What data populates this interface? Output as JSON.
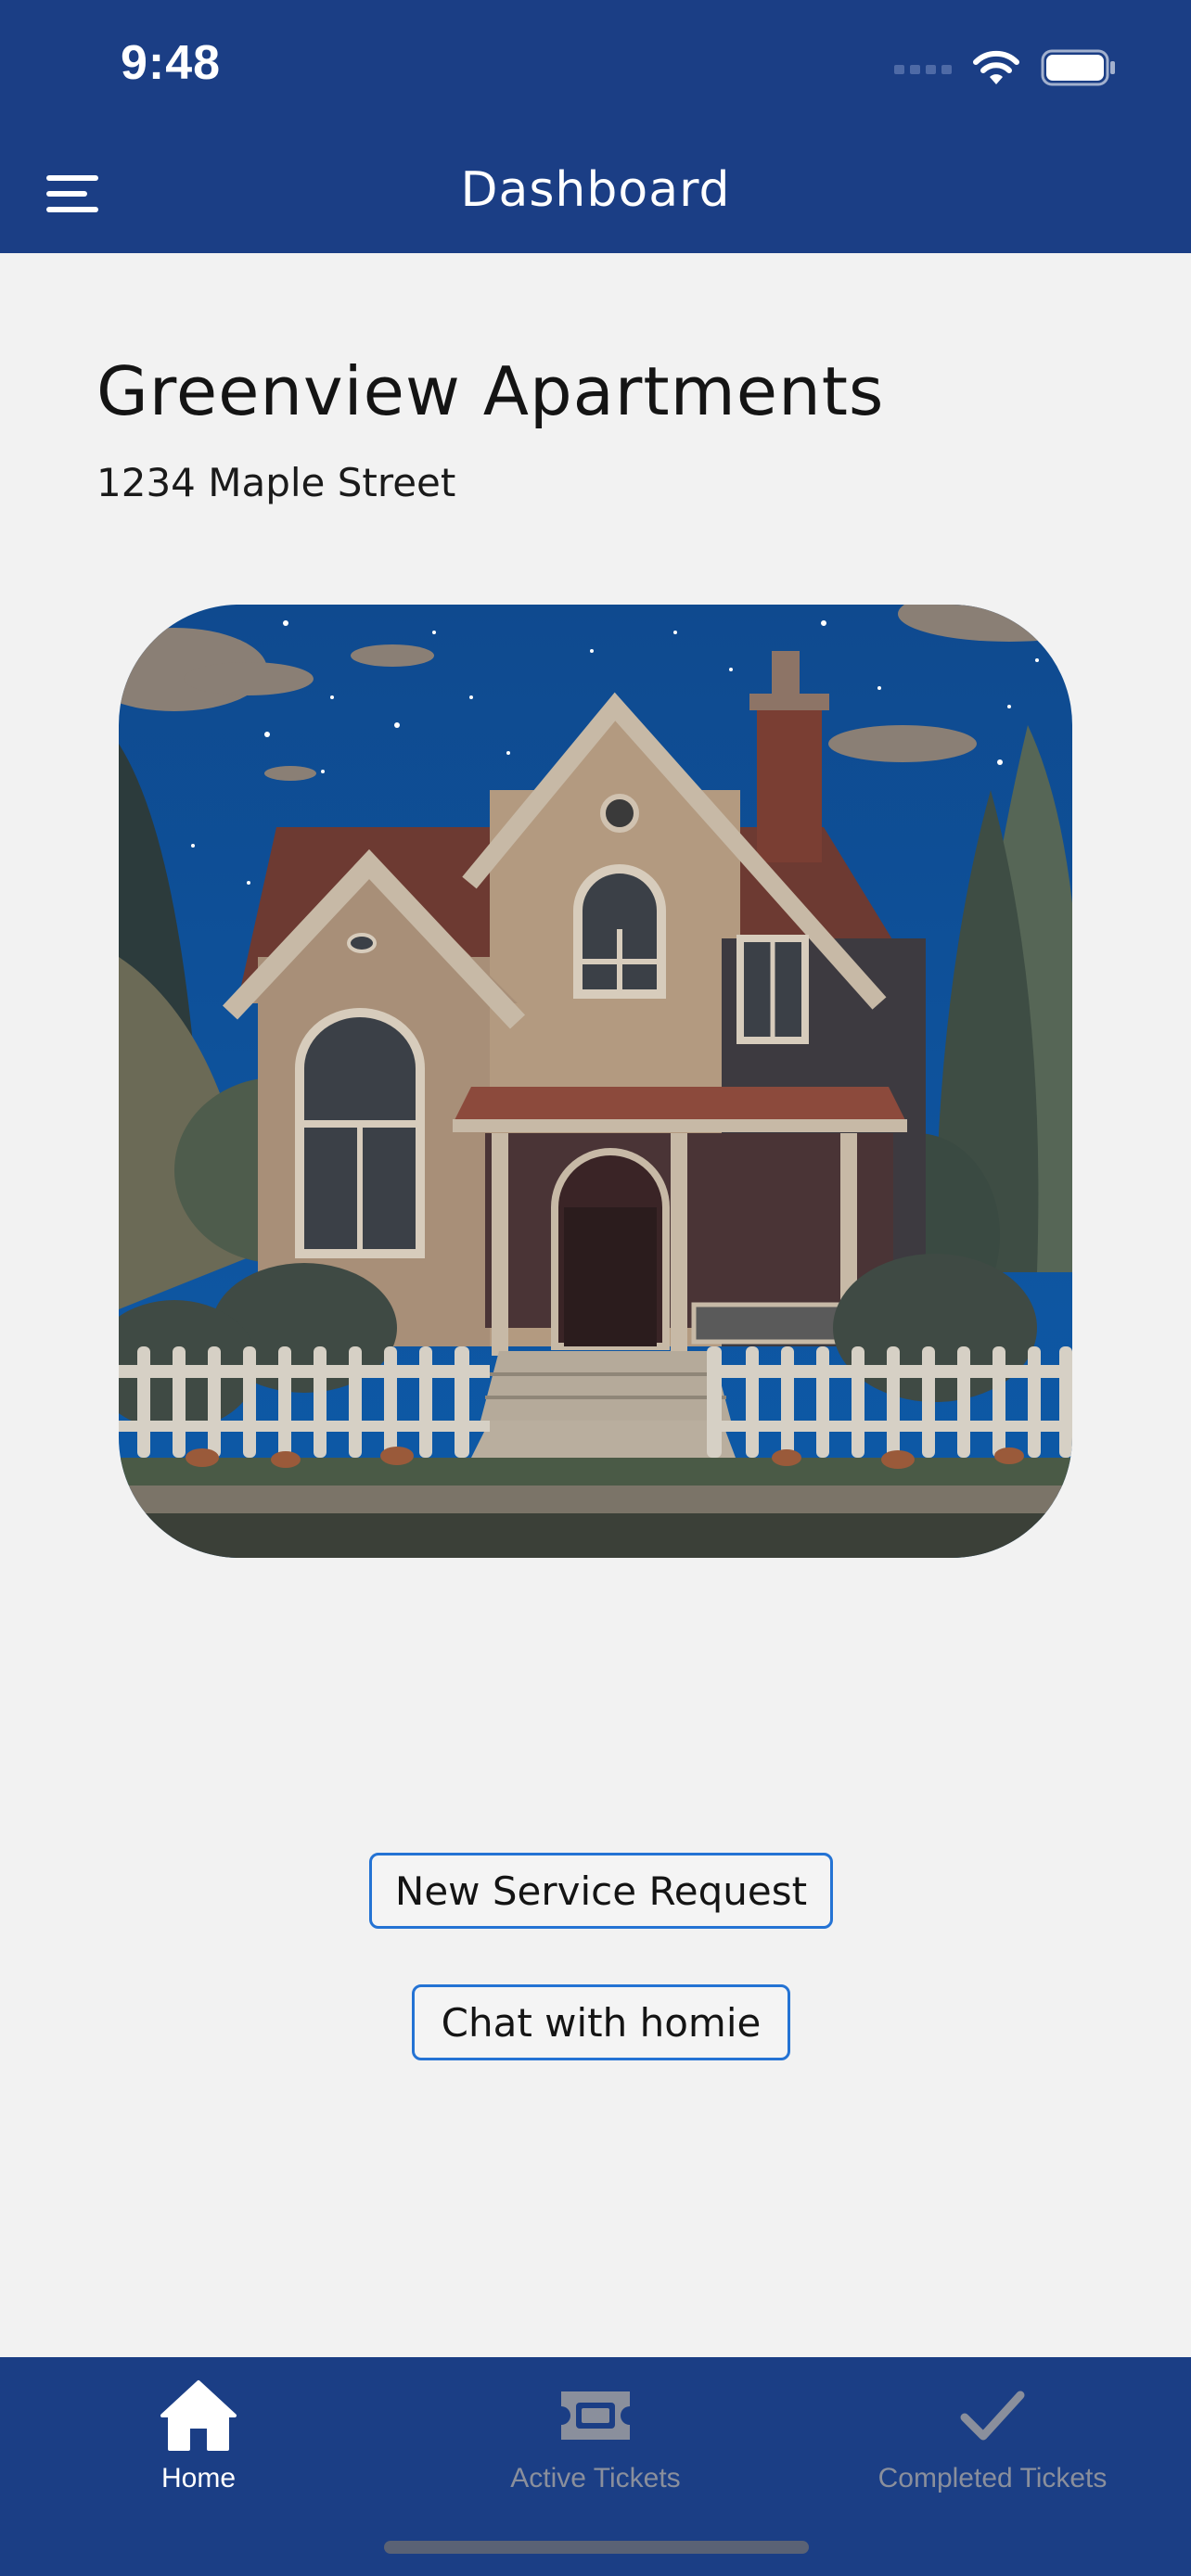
{
  "status_bar": {
    "time": "9:48",
    "icons": [
      "cellular-signal-icon",
      "wifi-icon",
      "battery-icon"
    ]
  },
  "header": {
    "title": "Dashboard",
    "menu_icon": "hamburger-menu-icon"
  },
  "property": {
    "name": "Greenview Apartments",
    "address": "1234 Maple Street"
  },
  "actions": {
    "new_service_request": "New Service Request",
    "chat": "Chat with homie"
  },
  "tabbar": {
    "tabs": [
      {
        "label": "Home",
        "icon": "home-icon",
        "active": true
      },
      {
        "label": "Active Tickets",
        "icon": "ticket-icon",
        "active": false
      },
      {
        "label": "Completed Tickets",
        "icon": "checkmark-icon",
        "active": false
      }
    ]
  },
  "colors": {
    "brand_blue": "#1b3e85",
    "button_border": "#2473d4",
    "background": "#f2f2f2",
    "tab_active": "#ffffff",
    "tab_inactive": "#8a8f9c"
  }
}
